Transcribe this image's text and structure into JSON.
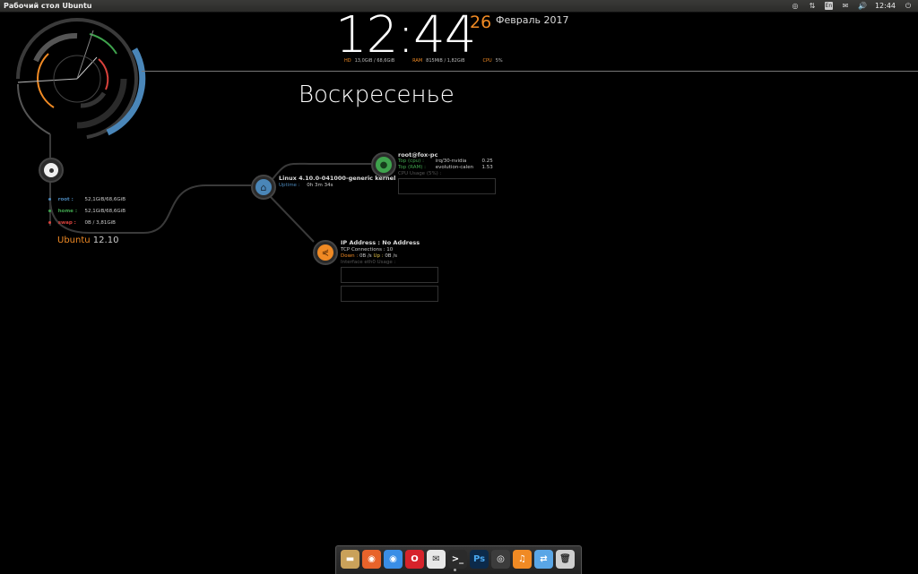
{
  "topbar": {
    "title": "Рабочий стол Ubuntu",
    "tray": [
      {
        "icon": "indicator-app-icon",
        "glyph": "◎"
      },
      {
        "icon": "network-arrows-icon",
        "glyph": "⇅"
      },
      {
        "icon": "keyboard-layout-icon",
        "glyph": "En"
      },
      {
        "icon": "messaging-icon",
        "glyph": "✉"
      },
      {
        "icon": "volume-icon",
        "glyph": "🔊"
      }
    ],
    "clock": "12:44",
    "power_glyph": "⏻"
  },
  "conky": {
    "time": "12:44",
    "day_number": "26",
    "month_year": "Февраль 2017",
    "weekday": "Воскресенье",
    "stats": {
      "hd_label": "HD",
      "hd_value": "13,0GiB / 68,6GiB",
      "ram_label": "RAM",
      "ram_value": "815MiB / 1,82GiB",
      "cpu_label": "CPU",
      "cpu_value": "5%"
    },
    "disks": [
      {
        "name": "root :",
        "value": "52,1GiB/68,6GiB",
        "color": "#4a86b8"
      },
      {
        "name": "home :",
        "value": "52,1GiB/68,6GiB",
        "color": "#3fa34d"
      },
      {
        "name": "swap :",
        "value": "0B   / 3,81GiB",
        "color": "#d9423c"
      }
    ],
    "distro_name": "Ubuntu",
    "distro_version": "12.10",
    "kernel": "Linux 4.10.0-041000-generic kernel",
    "uptime_label": "Uptime :",
    "uptime_value": "0h 3m 34s",
    "user": {
      "title": "root@fox-pc",
      "top_cpu_label": "Top (cpu) :",
      "top_cpu_proc": "irq/30-nvidia",
      "top_cpu_value": "0.25",
      "top_ram_label": "Top (RAM) :",
      "top_ram_proc": "evolution-calen",
      "top_ram_value": "1.53",
      "cpu_usage_label": "CPU Usage (5%) :"
    },
    "network": {
      "ip": "IP Address : No Address",
      "tcp": "TCP Connections : 10",
      "down_label": "Down :",
      "down_value": "0B   /s",
      "up_label": "Up :",
      "up_value": "0B   /s",
      "iface_label": "Interface eth0 Usage :"
    }
  },
  "colors": {
    "orange": "#f08a24",
    "blue": "#4a86b8",
    "green": "#3fa34d",
    "red": "#d9423c"
  },
  "dock": [
    {
      "name": "files-icon",
      "color": "#c9a15a",
      "glyph": "▬"
    },
    {
      "name": "firefox-icon",
      "color": "#e8632b",
      "glyph": "◉"
    },
    {
      "name": "chrome-icon",
      "color": "#3a8ee6",
      "glyph": "◉"
    },
    {
      "name": "opera-icon",
      "color": "#d6232b",
      "glyph": "O"
    },
    {
      "name": "mail-icon",
      "color": "#e8e8e8",
      "glyph": "✉"
    },
    {
      "name": "terminal-icon",
      "color": "#2b2b2b",
      "glyph": ">_"
    },
    {
      "name": "photoshop-icon",
      "color": "#0c2a4a",
      "glyph": "Ps"
    },
    {
      "name": "camera-icon",
      "color": "#3c3c3c",
      "glyph": "◎"
    },
    {
      "name": "music-icon",
      "color": "#f08a24",
      "glyph": "♫"
    },
    {
      "name": "settings-toggle-icon",
      "color": "#5aa6e6",
      "glyph": "⇄"
    },
    {
      "name": "trash-icon",
      "color": "#cfcfcf",
      "glyph": "🗑"
    }
  ]
}
